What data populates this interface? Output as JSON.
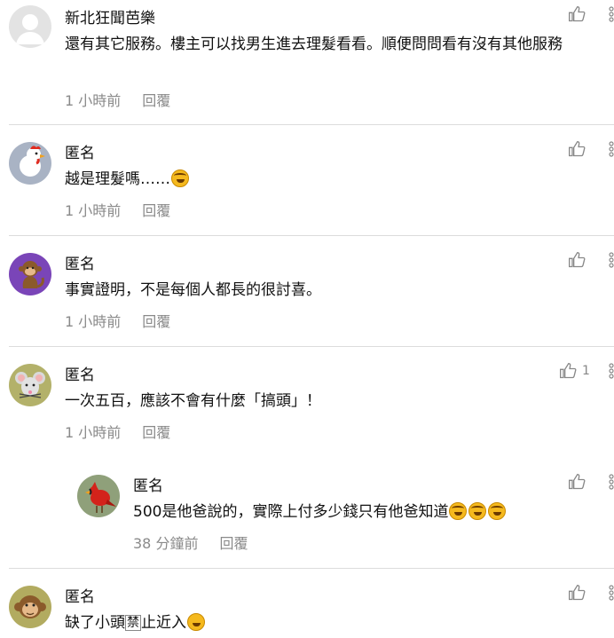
{
  "comments": [
    {
      "author": "新北狂聞芭樂",
      "text": "還有其它服務。樓主可以找男生進去理髮看看。順便問問看有沒有其他服務",
      "time": "1 小時前",
      "reply": "回覆",
      "likes": "",
      "avatar": "default-avatar"
    },
    {
      "author": "匿名",
      "text": "越是理髮嗎……",
      "emoji": "rolling-laugh",
      "time": "1 小時前",
      "reply": "回覆",
      "likes": "",
      "avatar": "chicken-avatar"
    },
    {
      "author": "匿名",
      "text": "事實證明，不是每個人都長的很討喜。",
      "time": "1 小時前",
      "reply": "回覆",
      "likes": "",
      "avatar": "monkey-avatar"
    },
    {
      "author": "匿名",
      "text": "一次五百，應該不會有什麼「搞頭」！",
      "time": "1 小時前",
      "reply": "回覆",
      "likes": "1",
      "avatar": "mouse-avatar"
    },
    {
      "author": "匿名",
      "text": "500是他爸說的，實際上付多少錢只有他爸知道",
      "time": "38 分鐘前",
      "reply": "回覆",
      "likes": "",
      "avatar": "cardinal-avatar"
    },
    {
      "author": "匿名",
      "text_before": "缺了小頭",
      "boxed_char": "禁",
      "text_after": "止近入",
      "time": "",
      "reply": "",
      "likes": "",
      "avatar": "monkey-face-avatar"
    }
  ]
}
